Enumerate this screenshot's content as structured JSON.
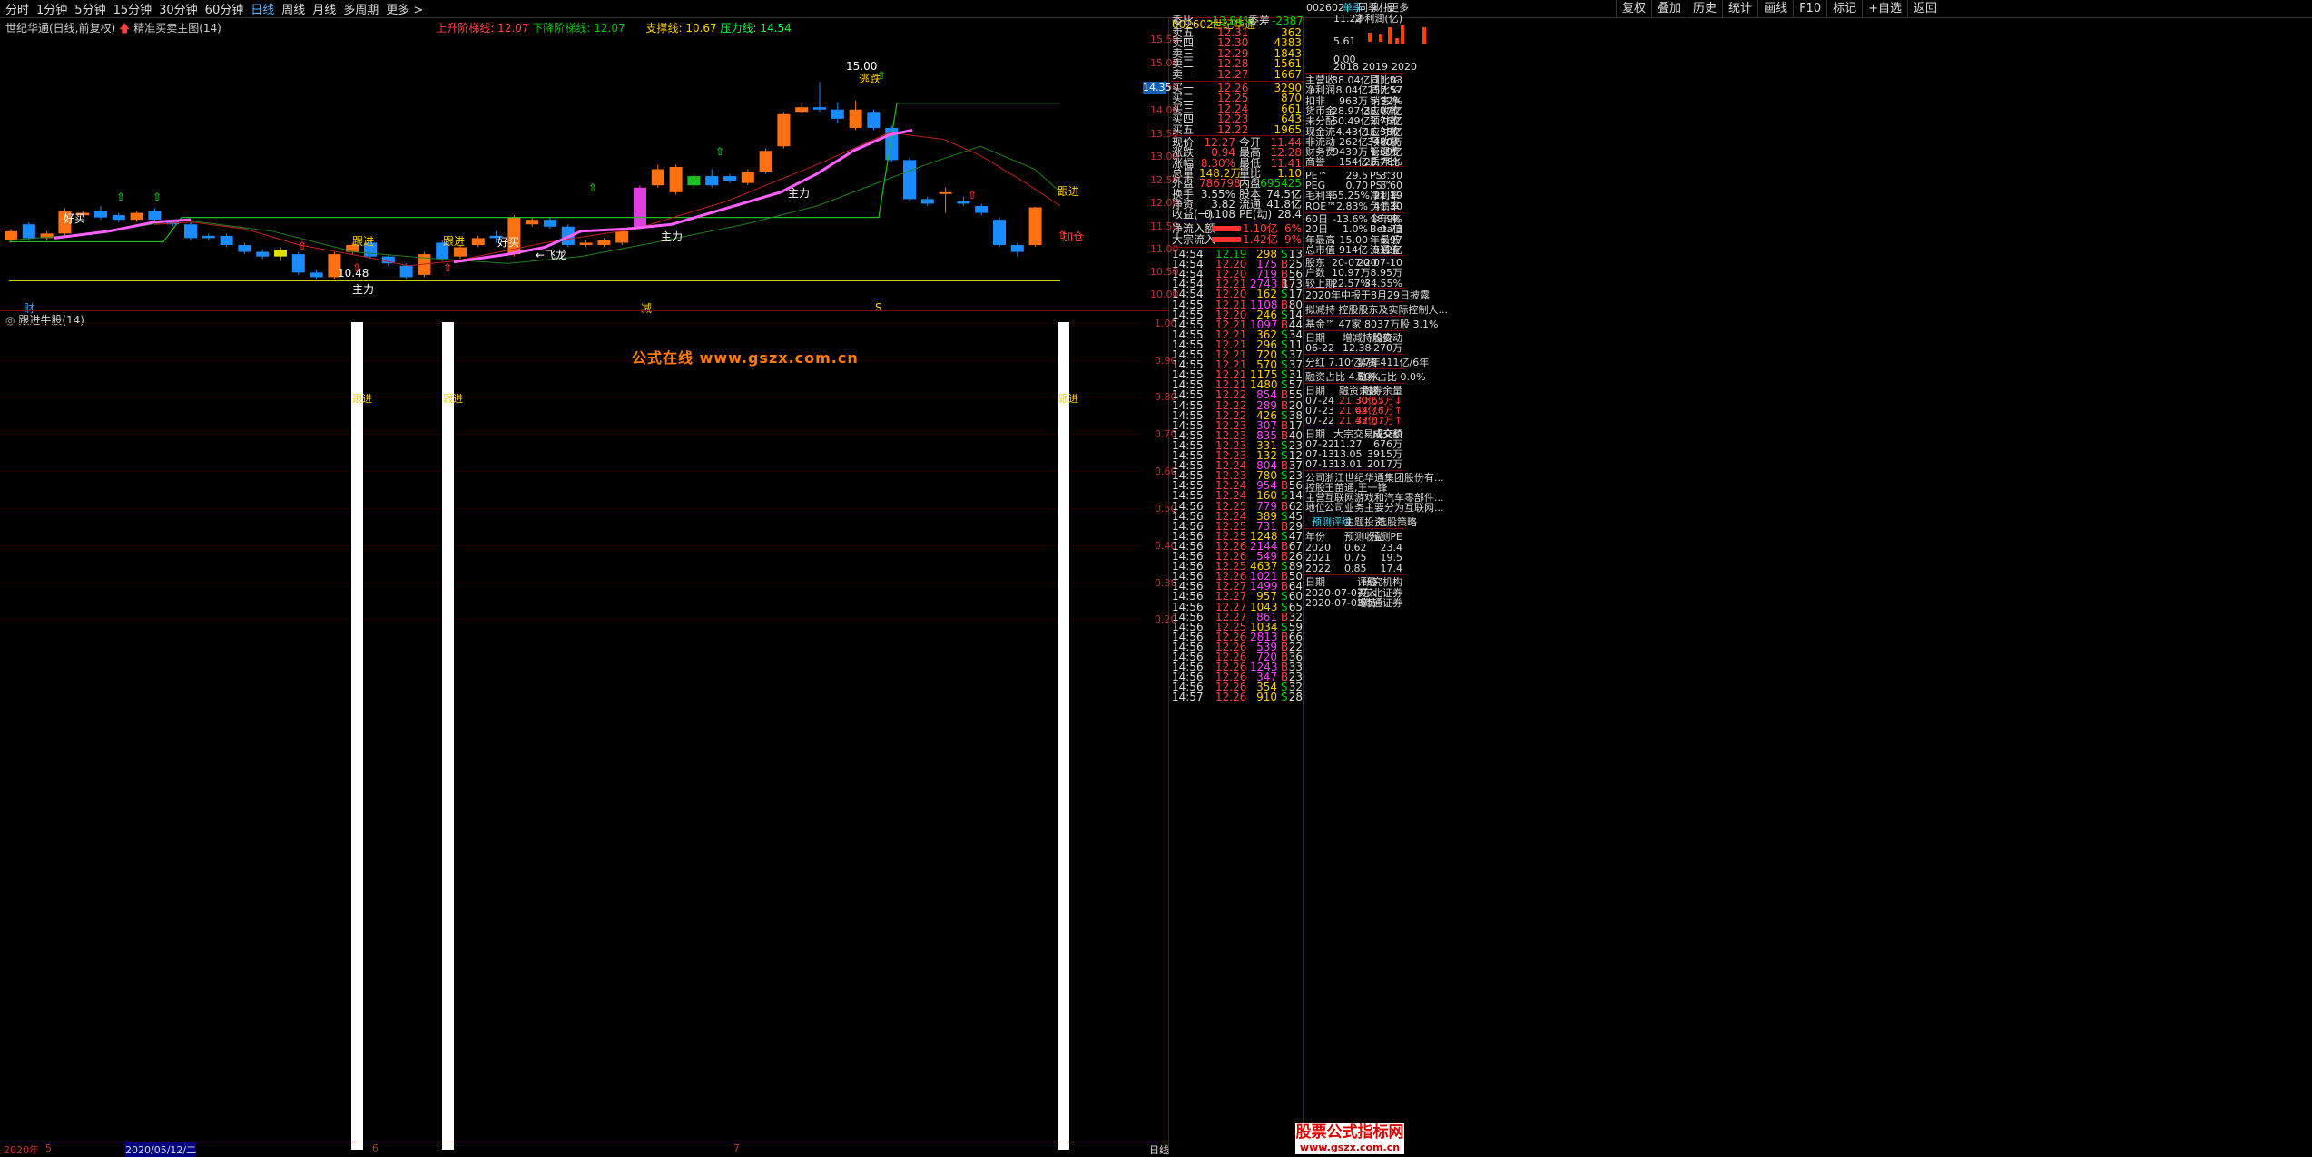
{
  "toolbar": {
    "items": [
      "分时",
      "1分钟",
      "5分钟",
      "15分钟",
      "30分钟",
      "60分钟",
      "日线",
      "周线",
      "月线",
      "多周期",
      "更多 >"
    ],
    "active": "日线",
    "right_items": [
      "复权",
      "叠加",
      "历史",
      "统计",
      "画线",
      "F10",
      "标记",
      "+自选",
      "返回"
    ]
  },
  "indicator_header": {
    "stock": "世纪华通(日线,前复权)",
    "name": "精准买卖主图(14)",
    "i1": "上升阶梯线: 12.07",
    "i2": "下降阶梯线: 12.07",
    "i3": "支撑线: 10.67",
    "i4": "压力线: 14.54"
  },
  "price_axis": [
    "15.50",
    "15.00",
    "14.50",
    "14.00",
    "13.50",
    "13.00",
    "12.50",
    "12.00",
    "11.50",
    "11.00",
    "10.50",
    "10.00"
  ],
  "current_price": "14.35",
  "sub_header": "跟进牛股(14)",
  "sub_axis": [
    "1.00",
    "0.90",
    "0.80",
    "0.70",
    "0.60",
    "0.50",
    "0.40",
    "0.30",
    "0.20"
  ],
  "watermark": "公式在线 www.gszx.com.cn",
  "chart_labels": {
    "follow": "跟进",
    "add": "加仓",
    "buy": "好买",
    "main": "主力",
    "fly": "←飞龙",
    "dip": "逃跌",
    "high": "15.00",
    "low": "10.48",
    "cai": "财",
    "jian": "减",
    "s": "S"
  },
  "x_axis": [
    "2020年",
    "5",
    "2020/05/12/二",
    "6",
    "7",
    "日线"
  ],
  "stock": {
    "code": "002602",
    "name": "世纪华通",
    "weibi": "-13.84%",
    "weicha": "-2387"
  },
  "asks": [
    [
      "卖五",
      "12.31",
      "362"
    ],
    [
      "卖四",
      "12.30",
      "4383"
    ],
    [
      "卖三",
      "12.29",
      "1843"
    ],
    [
      "卖二",
      "12.28",
      "1561"
    ],
    [
      "卖一",
      "12.27",
      "1667"
    ]
  ],
  "bids": [
    [
      "买一",
      "12.26",
      "3290"
    ],
    [
      "买二",
      "12.25",
      "870"
    ],
    [
      "买三",
      "12.24",
      "661"
    ],
    [
      "买四",
      "12.23",
      "643"
    ],
    [
      "买五",
      "12.22",
      "1965"
    ]
  ],
  "quote": [
    [
      "现价",
      "12.27",
      "今开",
      "11.44"
    ],
    [
      "涨跌",
      "0.94",
      "最高",
      "12.28"
    ],
    [
      "涨幅",
      "8.30%",
      "最低",
      "11.41"
    ],
    [
      "总量",
      "148.2万",
      "量比",
      "1.10"
    ],
    [
      "外盘",
      "786798",
      "内盘",
      "695425"
    ],
    [
      "换手",
      "3.55%",
      "股本",
      "74.5亿"
    ],
    [
      "净资",
      "3.82",
      "流通",
      "41.8亿"
    ],
    [
      "收益(一)",
      "0.108",
      "PE(动)",
      "28.4"
    ]
  ],
  "flows": [
    [
      "净流入额",
      "1.10亿",
      "6%"
    ],
    [
      "大宗流入",
      "1.42亿",
      "9%"
    ]
  ],
  "ticks": [
    [
      "14:54",
      "12.19",
      "298",
      "S",
      "13"
    ],
    [
      "14:54",
      "12.20",
      "175",
      "B",
      "25"
    ],
    [
      "14:54",
      "12.20",
      "719",
      "B",
      "56"
    ],
    [
      "14:54",
      "12.21",
      "2743",
      "B",
      "173"
    ],
    [
      "14:54",
      "12.20",
      "162",
      "S",
      "17"
    ],
    [
      "14:55",
      "12.21",
      "1108",
      "B",
      "80"
    ],
    [
      "14:55",
      "12.20",
      "246",
      "S",
      "14"
    ],
    [
      "14:55",
      "12.21",
      "1097",
      "B",
      "44"
    ],
    [
      "14:55",
      "12.21",
      "362",
      "S",
      "34"
    ],
    [
      "14:55",
      "12.21",
      "296",
      "S",
      "11"
    ],
    [
      "14:55",
      "12.21",
      "720",
      "S",
      "37"
    ],
    [
      "14:55",
      "12.21",
      "570",
      "S",
      "37"
    ],
    [
      "14:55",
      "12.21",
      "1175",
      "S",
      "31"
    ],
    [
      "14:55",
      "12.21",
      "1480",
      "S",
      "57"
    ],
    [
      "14:55",
      "12.22",
      "854",
      "B",
      "55"
    ],
    [
      "14:55",
      "12.22",
      "289",
      "B",
      "20"
    ],
    [
      "14:55",
      "12.22",
      "426",
      "S",
      "38"
    ],
    [
      "14:55",
      "12.23",
      "307",
      "B",
      "17"
    ],
    [
      "14:55",
      "12.23",
      "835",
      "B",
      "40"
    ],
    [
      "14:55",
      "12.23",
      "331",
      "S",
      "23"
    ],
    [
      "14:55",
      "12.23",
      "132",
      "S",
      "12"
    ],
    [
      "14:55",
      "12.24",
      "804",
      "B",
      "37"
    ],
    [
      "14:55",
      "12.23",
      "780",
      "S",
      "23"
    ],
    [
      "14:55",
      "12.24",
      "954",
      "B",
      "56"
    ],
    [
      "14:55",
      "12.24",
      "160",
      "S",
      "14"
    ],
    [
      "14:56",
      "12.25",
      "779",
      "B",
      "62"
    ],
    [
      "14:56",
      "12.24",
      "389",
      "S",
      "45"
    ],
    [
      "14:56",
      "12.25",
      "731",
      "B",
      "29"
    ],
    [
      "14:56",
      "12.25",
      "1248",
      "S",
      "47"
    ],
    [
      "14:56",
      "12.26",
      "2144",
      "B",
      "67"
    ],
    [
      "14:56",
      "12.26",
      "549",
      "B",
      "26"
    ],
    [
      "14:56",
      "12.25",
      "4637",
      "S",
      "89"
    ],
    [
      "14:56",
      "12.26",
      "1021",
      "B",
      "50"
    ],
    [
      "14:56",
      "12.27",
      "1499",
      "B",
      "64"
    ],
    [
      "14:56",
      "12.27",
      "957",
      "S",
      "60"
    ],
    [
      "14:56",
      "12.27",
      "1043",
      "S",
      "65"
    ],
    [
      "14:56",
      "12.27",
      "861",
      "B",
      "32"
    ],
    [
      "14:56",
      "12.25",
      "1034",
      "S",
      "59"
    ],
    [
      "14:56",
      "12.26",
      "2813",
      "B",
      "66"
    ],
    [
      "14:56",
      "12.26",
      "539",
      "B",
      "22"
    ],
    [
      "14:56",
      "12.26",
      "720",
      "B",
      "36"
    ],
    [
      "14:56",
      "12.26",
      "1243",
      "B",
      "33"
    ],
    [
      "14:56",
      "12.26",
      "347",
      "B",
      "23"
    ],
    [
      "14:56",
      "12.26",
      "354",
      "S",
      "32"
    ],
    [
      "14:57",
      "12.26",
      "910",
      "S",
      "28"
    ]
  ],
  "right": {
    "code": "002602",
    "tabs": [
      "单季",
      "同季",
      "财报",
      "更多"
    ],
    "chart_title": "净利润(亿)",
    "chart_vals": [
      "11.22",
      "5.61",
      "0.00"
    ],
    "years": [
      "2018",
      "2019",
      "2020"
    ],
    "fin": [
      [
        "主营收",
        "38.04亿",
        "同比%",
        "11.03"
      ],
      [
        "净利润",
        "8.04亿",
        "同比%",
        "257.57"
      ],
      [
        "扣非",
        "963万",
        "销售净",
        "5.32%"
      ],
      [
        "货币金",
        "28.97亿",
        "应收款",
        "38.07亿"
      ],
      [
        "未分配",
        "60.49亿",
        "预付款",
        "2.76亿"
      ],
      [
        "现金流",
        "4.43亿",
        "应付款",
        "11.38亿"
      ],
      [
        "非流动",
        "262亿",
        "预收款",
        "3480万"
      ],
      [
        "财务费",
        "9439万",
        "管理费",
        "1.69亿"
      ],
      [
        "商誉",
        "154亿",
        "质押比",
        "25.78%"
      ],
      [
        "PE™",
        "29.5",
        "PS™",
        "3.30"
      ],
      [
        "PEG",
        "0.70",
        "PS™",
        "5.60"
      ],
      [
        "毛利率",
        "55.25%",
        "净利率",
        "21.19"
      ],
      [
        "ROE™",
        "2.83%",
        "负债率",
        "41.30"
      ],
      [
        "60日",
        "-13.6%",
        "今年来",
        "18.9%"
      ],
      [
        "20日",
        "1.0%",
        "Beta值",
        "0.73"
      ],
      [
        "年最高",
        "15.00",
        "年最低",
        "6.97"
      ],
      [
        "总市值",
        "914亿",
        "流通值",
        "512亿"
      ],
      [
        "股东",
        "20-07-20",
        "",
        "20-07-10"
      ],
      [
        "户数",
        "10.97万",
        "",
        "8.95万"
      ],
      [
        "较上期",
        "22.57%",
        "",
        "34.55%"
      ]
    ],
    "notes": [
      "2020年中报于8月29日披露",
      "拟减持 控股股东及实际控制人...",
      "基金™ 47家 8037万股 3.1%"
    ],
    "inc": [
      [
        "日期",
        "增减持均价",
        "持股变动"
      ],
      [
        "06-22",
        "12.38",
        "-270万"
      ]
    ],
    "div": [
      "分红 7.10亿/7年",
      "募资 411亿/6年"
    ],
    "margin_ratio": [
      "融资占比 4.50%",
      "融券占比 0.0%"
    ],
    "margin": [
      [
        "日期",
        "融资余额",
        "融券余量"
      ],
      [
        "07-24",
        "21.30亿↓",
        "30.65万↓"
      ],
      [
        "07-23",
        "21.62亿↑",
        "44.76万↑"
      ],
      [
        "07-22",
        "21.43亿↑",
        "32.07万↑"
      ]
    ],
    "block": [
      [
        "日期",
        "大宗交易成交价",
        "成交额"
      ],
      [
        "07-22",
        "11.27",
        "676万"
      ],
      [
        "07-13",
        "13.05",
        "3915万"
      ],
      [
        "07-13",
        "13.01",
        "2017万"
      ]
    ],
    "profile": [
      [
        "公司",
        "浙江世纪华通集团股份有..."
      ],
      [
        "控股",
        "王苗通,王一锋"
      ],
      [
        "主营",
        "互联网游戏和汽车零部件..."
      ],
      [
        "地位",
        "公司业务主要分为互联网..."
      ]
    ],
    "fc_tabs": [
      "预测评级",
      "主题投资",
      "选股策略"
    ],
    "forecast": [
      [
        "年份",
        "预测收益",
        "预测PE"
      ],
      [
        "2020",
        "0.62",
        "23.4"
      ],
      [
        "2021",
        "0.75",
        "19.5"
      ],
      [
        "2022",
        "0.85",
        "17.4"
      ]
    ],
    "rating": [
      [
        "日期",
        "评级",
        "研究机构"
      ],
      [
        "2020-07-07",
        "买入",
        "东北证券"
      ],
      [
        "2020-07-03",
        "增持",
        "海通证券"
      ]
    ]
  },
  "logo": {
    "line1": "股票公式指标网",
    "line2": "www.gszx.com.cn"
  },
  "colors": {
    "up": "#ff7010",
    "down": "#1a8cff",
    "ma": "#ff60ff",
    "red": "#ff4040",
    "green": "#00c000"
  }
}
